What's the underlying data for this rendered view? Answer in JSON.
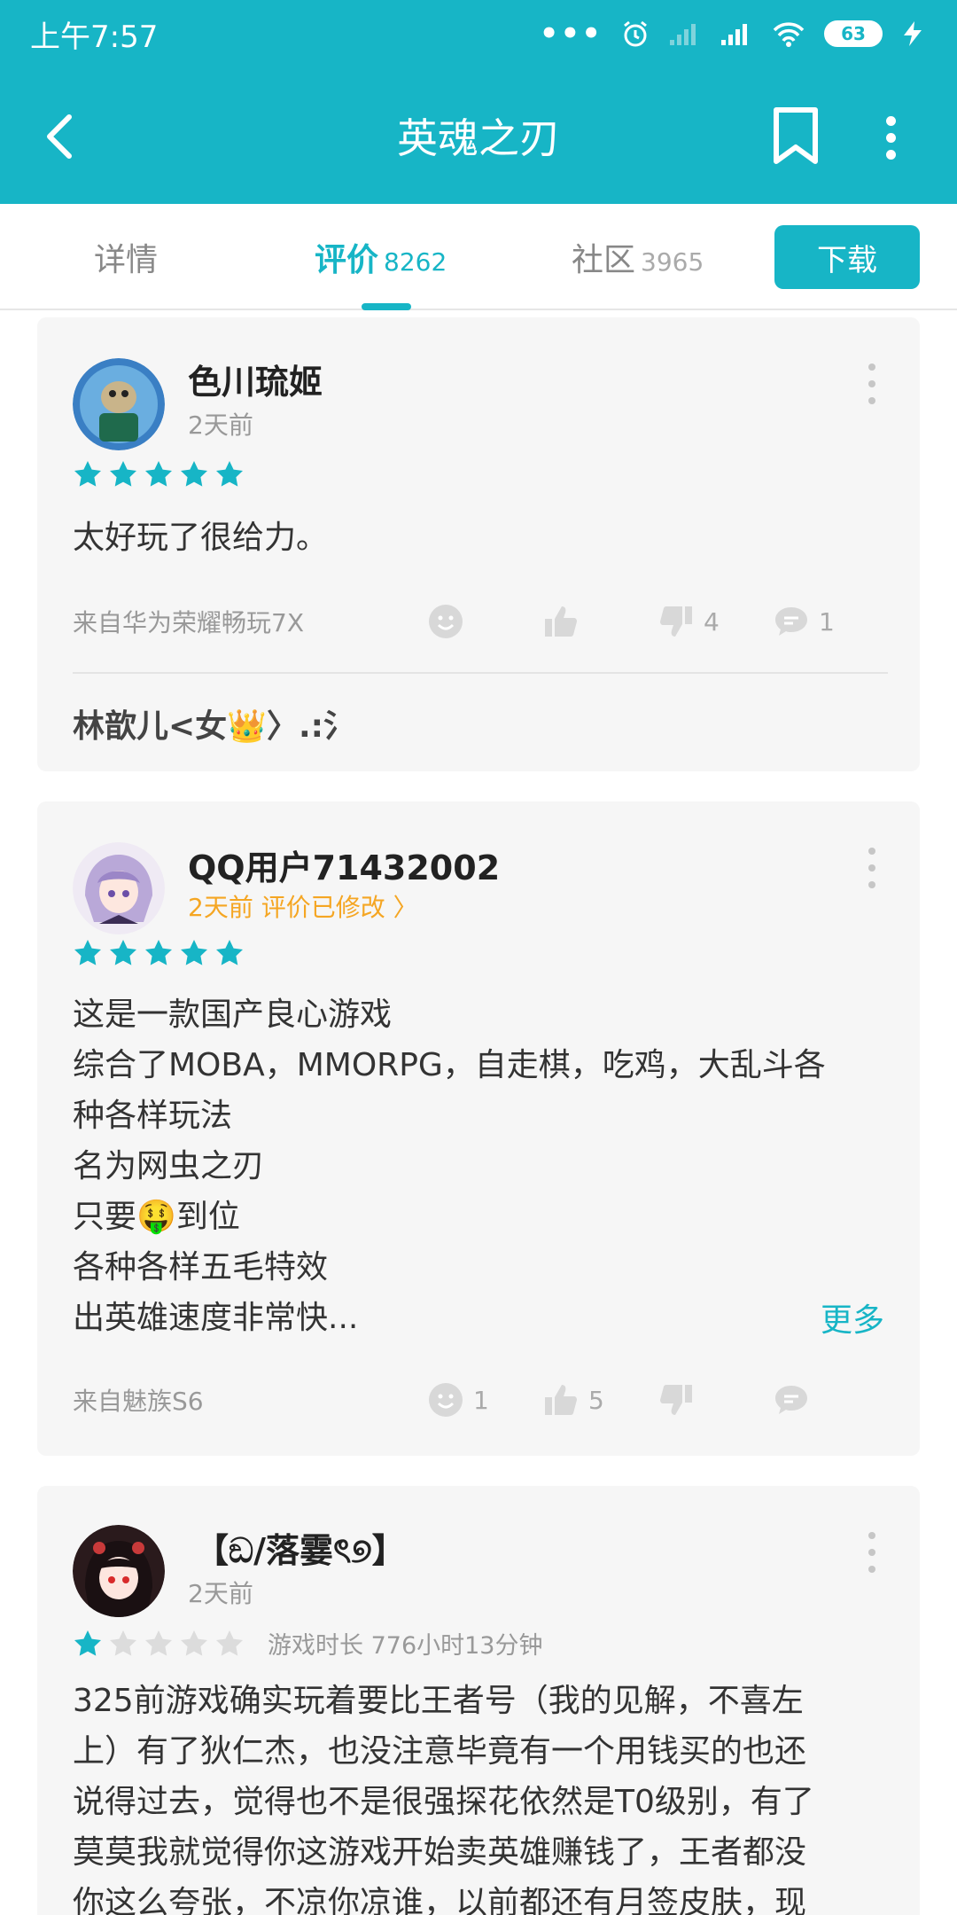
{
  "status_bar": {
    "time": "上午7:57",
    "dots": "•••",
    "battery": "63"
  },
  "app_bar": {
    "title": "英魂之刃",
    "icons": [
      "back-icon",
      "bookmark-icon",
      "more-vert-icon"
    ]
  },
  "tabs": [
    {
      "label": "详情",
      "count": ""
    },
    {
      "label": "评价",
      "count": "8262",
      "active": true
    },
    {
      "label": "社区",
      "count": "3965"
    }
  ],
  "download_label": "下载",
  "accent_color": "#17b5c6",
  "reviews": [
    {
      "user": "色川琉姬",
      "meta": "2天前",
      "rating": 5,
      "text": [
        "太好玩了很给力。"
      ],
      "source": "来自华为荣耀畅玩7X",
      "likes": "",
      "dislikes": "4",
      "comments": "1",
      "reply_preview": "林歆儿<女👑〉.:氵"
    },
    {
      "user": "QQ用户71432002",
      "meta": "2天前 评价已修改 〉",
      "rating": 5,
      "text": [
        "这是一款国产良心游戏",
        "综合了MOBA，MMORPG，自走棋，吃鸡，大乱斗各",
        "种各样玩法",
        "名为网虫之刃",
        "只要🤑到位",
        "各种各样五毛特效",
        "出英雄速度非常快..."
      ],
      "more": "更多",
      "source": "来自魅族S6",
      "smile": "1",
      "likes": "5",
      "dislikes": "",
      "comments": ""
    },
    {
      "user": "【ඞ/落霎ৎ୭】",
      "meta": "2天前",
      "rating": 1,
      "playtime": "游戏时长 776小时13分钟",
      "text": [
        "325前游戏确实玩着要比王者号（我的见解，不喜左",
        "上）有了狄仁杰，也没注意毕竟有一个用钱买的也还",
        "说得过去，觉得也不是很强探花依然是T0级别，有了",
        "莫莫我就觉得你这游戏开始卖英雄赚钱了，王者都没",
        "你这么夸张，不凉你凉谁，以前都还有月签皮肤，现"
      ]
    }
  ]
}
